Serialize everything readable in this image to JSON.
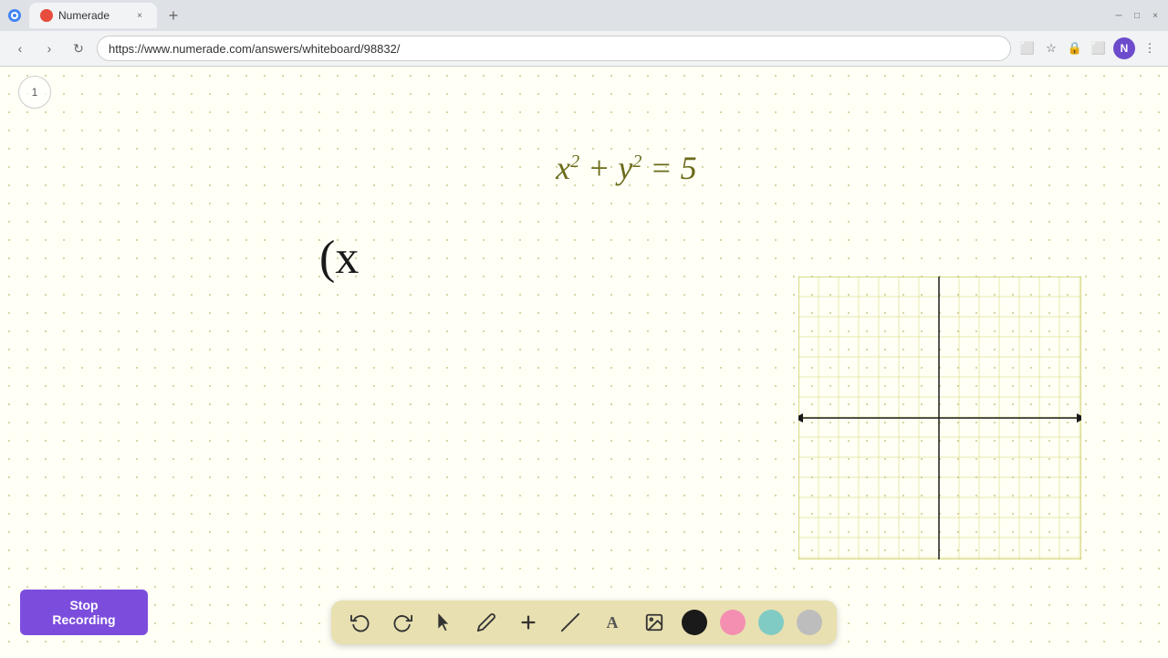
{
  "browser": {
    "tab_title": "Numerade",
    "url": "https://www.numerade.com/answers/whiteboard/98832/",
    "tab_close_label": "×",
    "tab_new_label": "+",
    "nav": {
      "back": "‹",
      "forward": "›",
      "refresh": "↻"
    }
  },
  "whiteboard": {
    "page_number": "1",
    "equation": "x² + y² = 5",
    "partial_expr": "(x"
  },
  "toolbar": {
    "undo_label": "↩",
    "redo_label": "↪",
    "select_label": "▶",
    "pen_label": "✏",
    "add_label": "+",
    "eraser_label": "/",
    "text_label": "A",
    "image_label": "🖼"
  },
  "colors": {
    "black": "#1a1a1a",
    "pink": "#f48fb1",
    "green": "#80cbc4",
    "gray": "#bdbdbd"
  },
  "stop_recording": {
    "label": "Stop Recording"
  },
  "graph": {
    "grid_color": "#b5b520",
    "axis_color": "#1a1a1a",
    "rows": 14,
    "cols": 14
  }
}
